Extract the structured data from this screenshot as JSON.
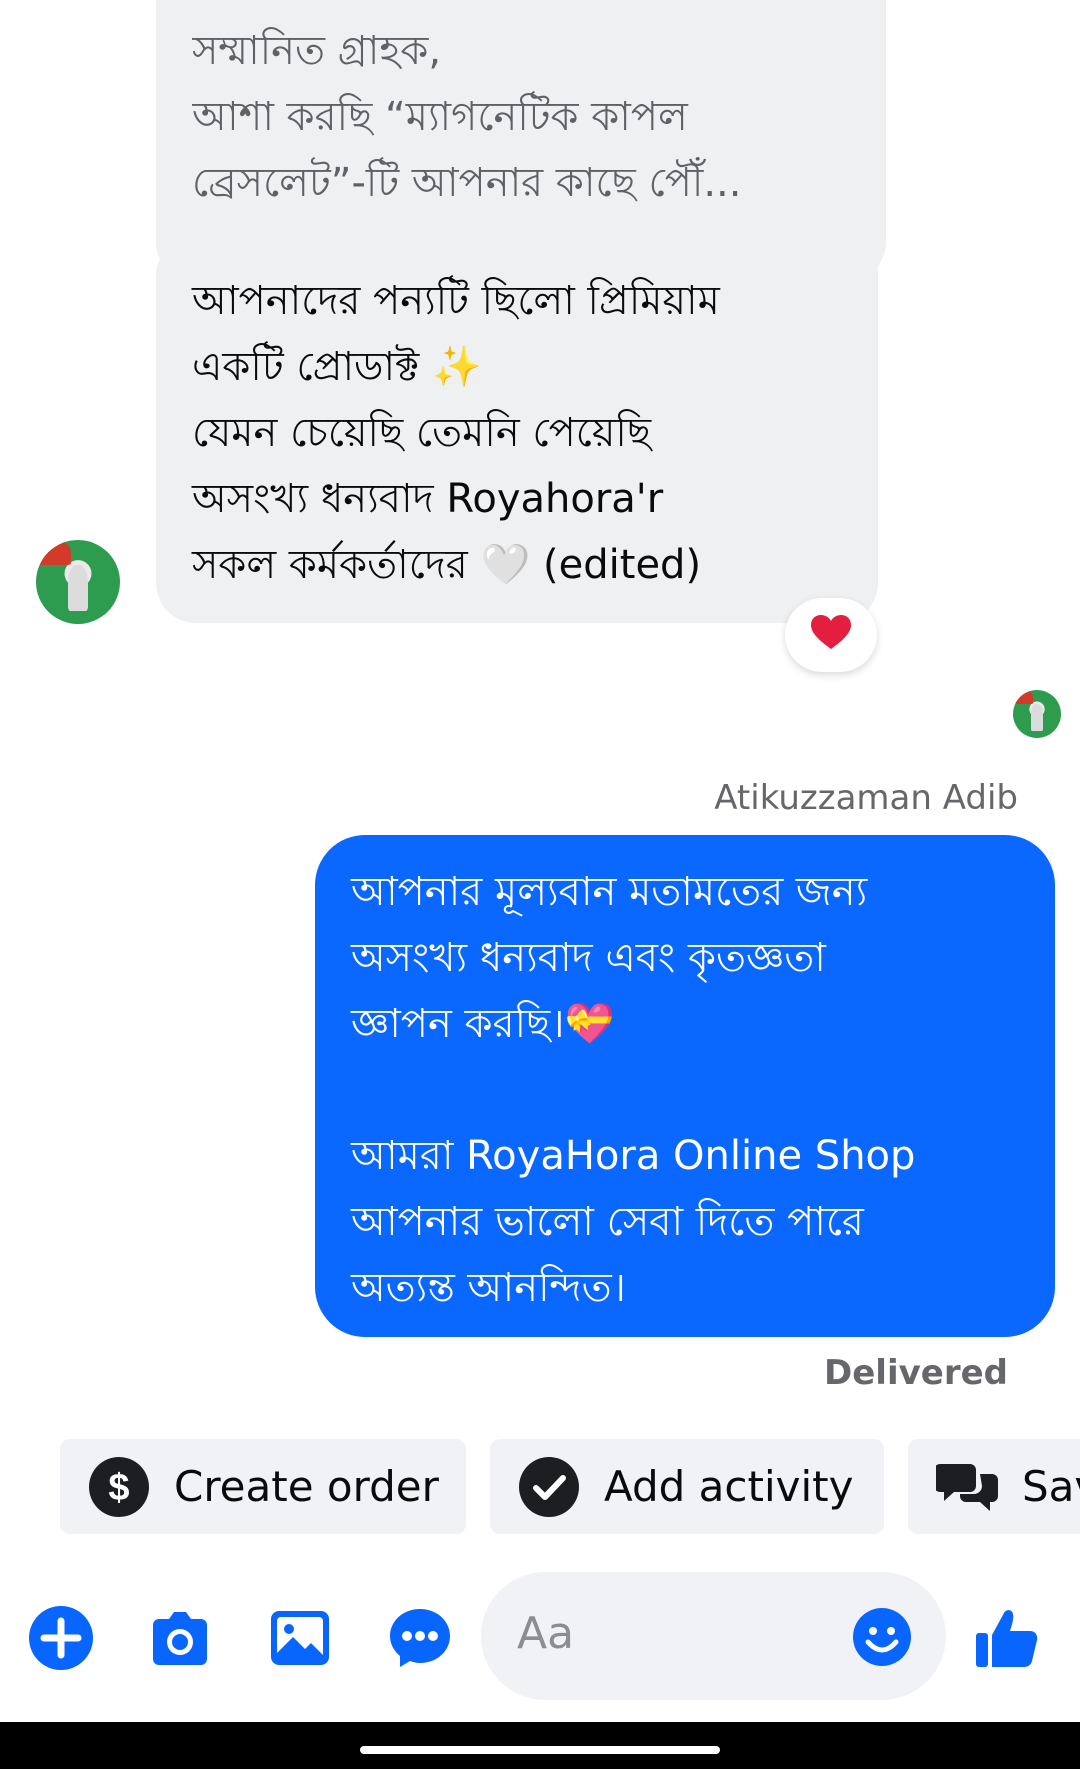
{
  "quoted_message": {
    "lines": [
      "সম্মানিত গ্রাহক,",
      "আশা করছি “ম্যাগনেটিক কাপল",
      "ব্রেসলেট”-টি আপনার কাছে পৌঁ..."
    ]
  },
  "incoming_message": {
    "lines": [
      "আপনাদের পন্যটি ছিলো প্রিমিয়াম",
      "একটি প্রোডাক্ট ✨",
      "যেমন চেয়েছি তেমনি পেয়েছি",
      "অসংখ্য ধন্যবাদ Royahora'r",
      "সকল কর্মকর্তাদের 🤍 (edited)"
    ],
    "reaction": "❤️"
  },
  "sender_name": "Atikuzzaman Adib",
  "outgoing_message": {
    "lines": [
      "আপনার মূল্যবান মতামতের জন্য",
      "অসংখ্য ধন্যবাদ এবং কৃতজ্ঞতা",
      "জ্ঞাপন করছি।💝"
    ],
    "lines2": [
      "আমরা RoyaHora Online Shop",
      "আপনার ভালো সেবা দিতে পারে",
      "অত্যন্ত আনন্দিত।"
    ]
  },
  "status": "Delivered",
  "quick_actions": [
    "Create order",
    "Add activity",
    "Saved replies"
  ],
  "composer": {
    "placeholder": "Aa"
  },
  "colors": {
    "accent": "#0a68ff",
    "bubble_gray": "#eef0f2",
    "icon_blue": "#0866ff"
  },
  "icons": [
    "plus-icon",
    "camera-icon",
    "gallery-icon",
    "chat-bubble-icon",
    "emoji-icon",
    "like-icon",
    "dollar-icon",
    "check-circle-icon",
    "chat-bubbles-icon"
  ]
}
